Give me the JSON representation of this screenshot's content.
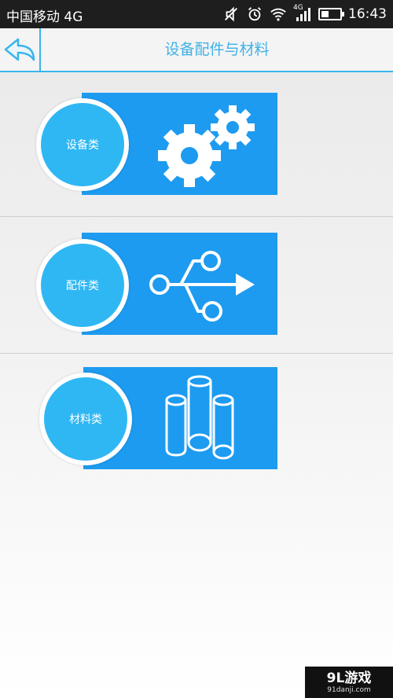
{
  "status_bar": {
    "carrier": "中国移动 4G",
    "network_label": "4G",
    "time": "16:43",
    "battery_level": 0.4
  },
  "header": {
    "title": "设备配件与材料",
    "back_icon": "back-arrow-icon"
  },
  "categories": [
    {
      "label": "设备类",
      "icon": "gears-icon"
    },
    {
      "label": "配件类",
      "icon": "usb-icon"
    },
    {
      "label": "材料类",
      "icon": "pipes-icon"
    }
  ],
  "colors": {
    "accent": "#39b5ec",
    "card": "#1d9bf0",
    "circle": "#2fb7f3",
    "status_bar": "#1e1e1e"
  },
  "watermark": {
    "main": "9L游戏",
    "sub": "91danji.com"
  }
}
